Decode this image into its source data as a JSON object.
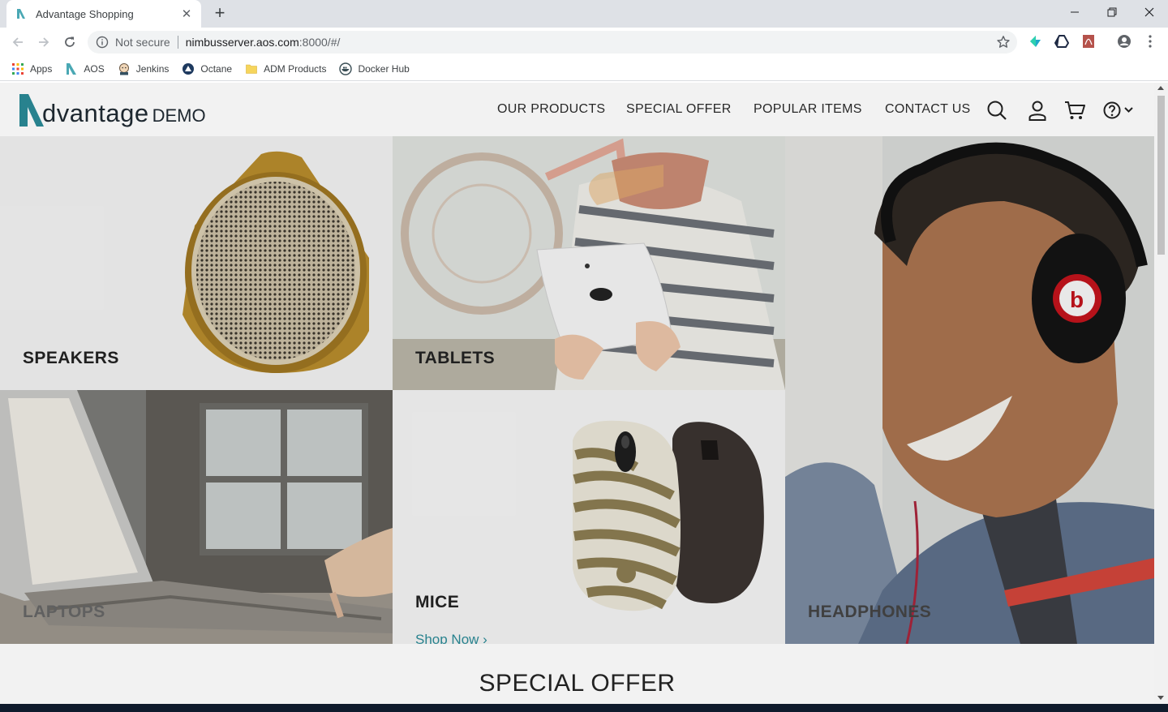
{
  "browser": {
    "tab_title": "Advantage Shopping",
    "security_label": "Not secure",
    "url_host": "nimbusserver.aos.com",
    "url_rest": ":8000/#/"
  },
  "bookmarks": [
    {
      "label": "Apps",
      "icon": "apps-grid-icon"
    },
    {
      "label": "AOS",
      "icon": "aos-logo-icon"
    },
    {
      "label": "Jenkins",
      "icon": "jenkins-icon"
    },
    {
      "label": "Octane",
      "icon": "octane-icon"
    },
    {
      "label": "ADM Products",
      "icon": "folder-icon"
    },
    {
      "label": "Docker Hub",
      "icon": "docker-icon"
    }
  ],
  "site": {
    "logo_word": "dvantage",
    "logo_demo": "DEMO",
    "nav": [
      "OUR PRODUCTS",
      "SPECIAL OFFER",
      "POPULAR ITEMS",
      "CONTACT US"
    ],
    "categories": {
      "speakers": "SPEAKERS",
      "tablets": "TABLETS",
      "laptops": "LAPTOPS",
      "mice": "MICE",
      "headphones": "HEADPHONES"
    },
    "shop_now": "Shop Now",
    "special_offer_heading": "SPECIAL OFFER"
  },
  "colors": {
    "brand_teal": "#2b8a96",
    "logo_dark": "#1f2a32"
  }
}
